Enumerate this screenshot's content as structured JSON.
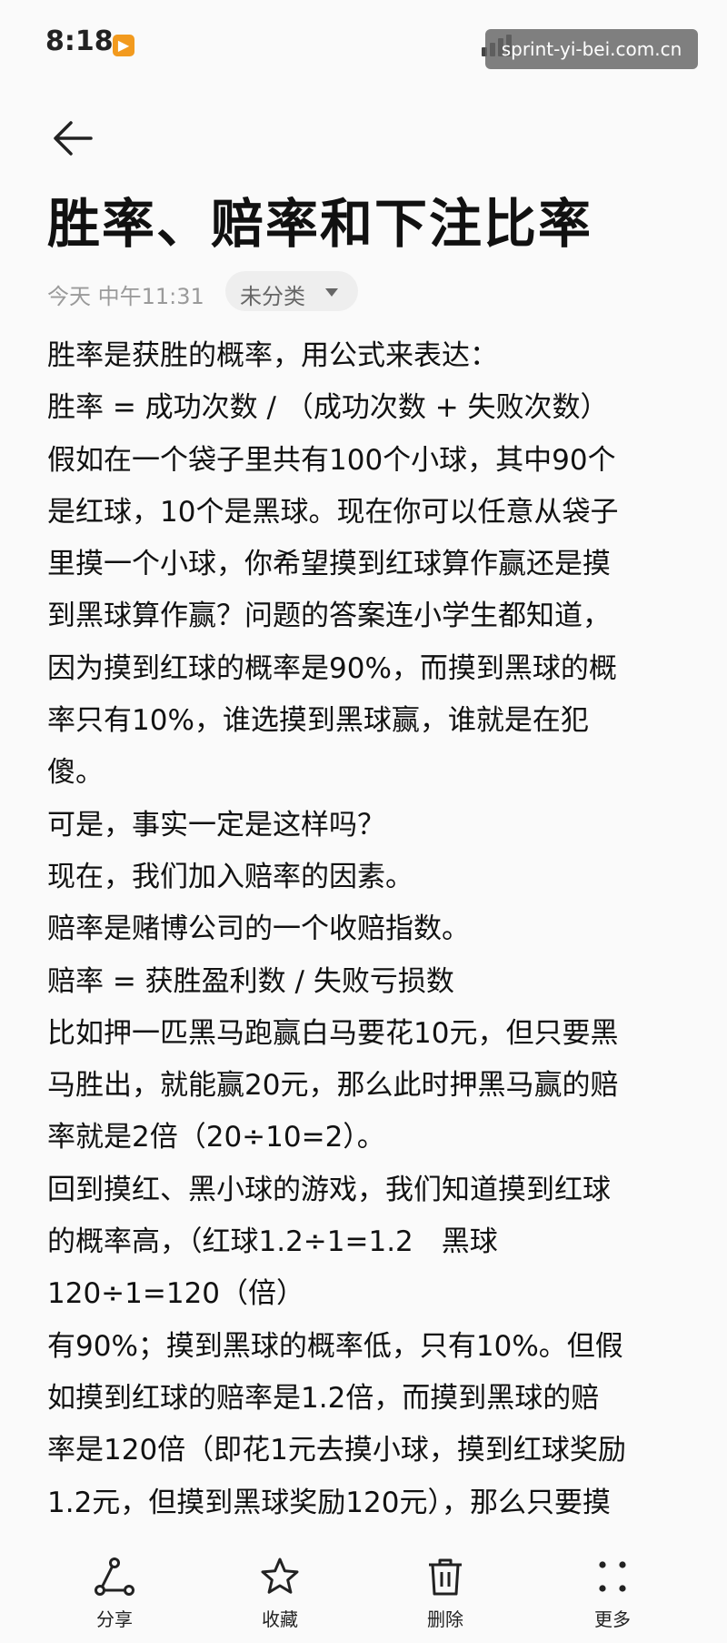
{
  "status_bar": {
    "time": "8:18",
    "app_badge": "▶",
    "watermark": "sprint-yi-bei.com.cn"
  },
  "note": {
    "title": "胜率、赔率和下注比率",
    "timestamp": "今天 中午11:31",
    "category": "未分类",
    "lines": [
      "胜率是获胜的概率，用公式来表达：",
      "胜率 = 成功次数 / （成功次数 + 失败次数）",
      "假如在一个袋子里共有100个小球，其中90个",
      "是红球，10个是黑球。现在你可以任意从袋子",
      "里摸一个小球，你希望摸到红球算作赢还是摸",
      "到黑球算作赢？问题的答案连小学生都知道，",
      "因为摸到红球的概率是90%，而摸到黑球的概",
      "率只有10%，谁选摸到黑球赢，谁就是在犯",
      "傻。",
      "可是，事实一定是这样吗？",
      "现在，我们加入赔率的因素。",
      "赔率是赌博公司的一个收赔指数。",
      "赔率 = 获胜盈利数 / 失败亏损数",
      "比如押一匹黑马跑赢白马要花10元，但只要黑",
      "马胜出，就能赢20元，那么此时押黑马赢的赔",
      "率就是2倍（20÷10=2）。",
      "回到摸红、黑小球的游戏，我们知道摸到红球",
      "的概率高，（红球1.2÷1=1.2　黑球",
      "120÷1=120（倍）",
      "有90%；摸到黑球的概率低，只有10%。但假",
      "如摸到红球的赔率是1.2倍，而摸到黑球的赔",
      "率是120倍（即花1元去摸小球，摸到红球奖励",
      "1.2元，但摸到黑球奖励120元），那么只要摸"
    ]
  },
  "toolbar": {
    "share": "分享",
    "favorite": "收藏",
    "delete": "删除",
    "more": "更多"
  },
  "colors": {
    "background": "#fafafa",
    "text": "#111111",
    "meta_text": "#9a9a9a",
    "chip_bg": "#eeeeee",
    "app_badge": "#f29a1e"
  }
}
